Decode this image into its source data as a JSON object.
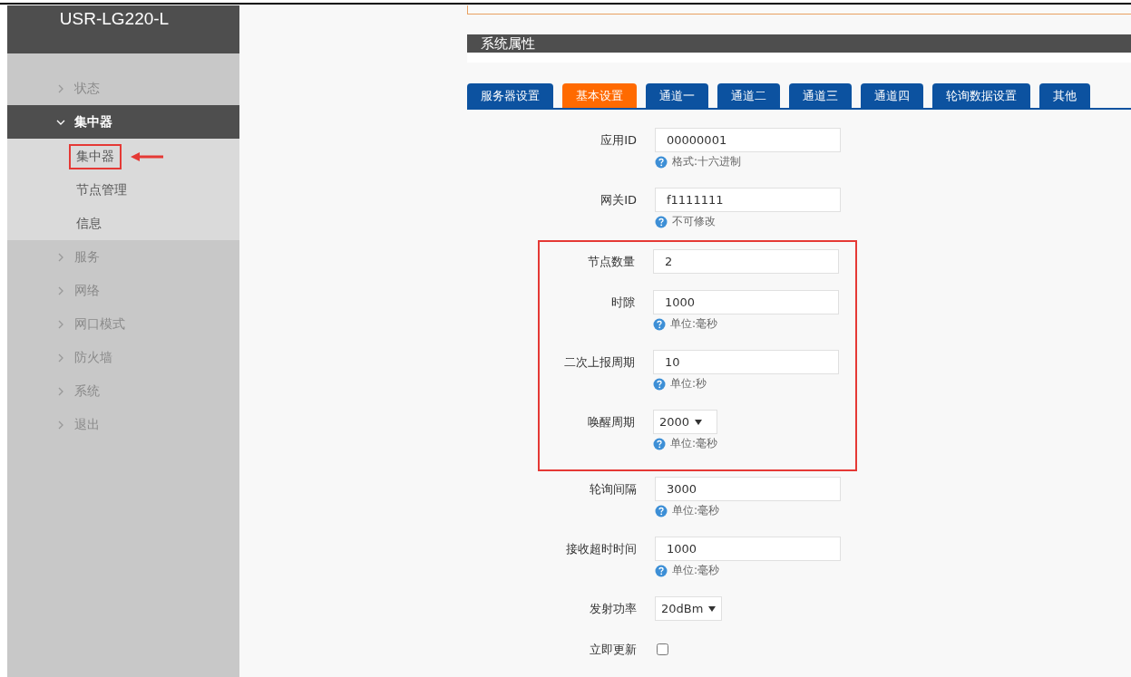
{
  "sidebar": {
    "title": "USR-LG220-L",
    "items": [
      {
        "label": "状态",
        "expanded": false
      },
      {
        "label": "集中器",
        "expanded": true,
        "children": [
          {
            "label": "集中器",
            "highlighted": true
          },
          {
            "label": "节点管理",
            "highlighted": false
          },
          {
            "label": "信息",
            "highlighted": false
          }
        ]
      },
      {
        "label": "服务",
        "expanded": false
      },
      {
        "label": "网络",
        "expanded": false
      },
      {
        "label": "网口模式",
        "expanded": false
      },
      {
        "label": "防火墙",
        "expanded": false
      },
      {
        "label": "系统",
        "expanded": false
      },
      {
        "label": "退出",
        "expanded": false
      }
    ]
  },
  "section": {
    "title": "系统属性"
  },
  "tabs": [
    {
      "label": "服务器设置",
      "selected": false
    },
    {
      "label": "基本设置",
      "selected": true
    },
    {
      "label": "通道一",
      "selected": false
    },
    {
      "label": "通道二",
      "selected": false
    },
    {
      "label": "通道三",
      "selected": false
    },
    {
      "label": "通道四",
      "selected": false
    },
    {
      "label": "轮询数据设置",
      "selected": false
    },
    {
      "label": "其他",
      "selected": false
    }
  ],
  "form": [
    {
      "kind": "text",
      "label": "应用ID",
      "value": "00000001",
      "hint": "格式:十六进制",
      "highlighted": false
    },
    {
      "kind": "text",
      "label": "网关ID",
      "value": "f1111111",
      "hint": "不可修改",
      "highlighted": false
    },
    {
      "kind": "text",
      "label": "节点数量",
      "value": "2",
      "highlighted": true
    },
    {
      "kind": "text",
      "label": "时隙",
      "value": "1000",
      "hint": "单位:毫秒",
      "highlighted": true
    },
    {
      "kind": "text",
      "label": "二次上报周期",
      "value": "10",
      "hint": "单位:秒",
      "highlighted": true
    },
    {
      "kind": "select",
      "label": "唤醒周期",
      "value": "2000",
      "hint": "单位:毫秒",
      "highlighted": true
    },
    {
      "kind": "text",
      "label": "轮询间隔",
      "value": "3000",
      "hint": "单位:毫秒",
      "highlighted": false
    },
    {
      "kind": "text",
      "label": "接收超时时间",
      "value": "1000",
      "hint": "单位:毫秒",
      "highlighted": false
    },
    {
      "kind": "select",
      "label": "发射功率",
      "value": "20dBm",
      "highlighted": false
    },
    {
      "kind": "checkbox",
      "label": "立即更新",
      "checked": false,
      "highlighted": false
    }
  ]
}
